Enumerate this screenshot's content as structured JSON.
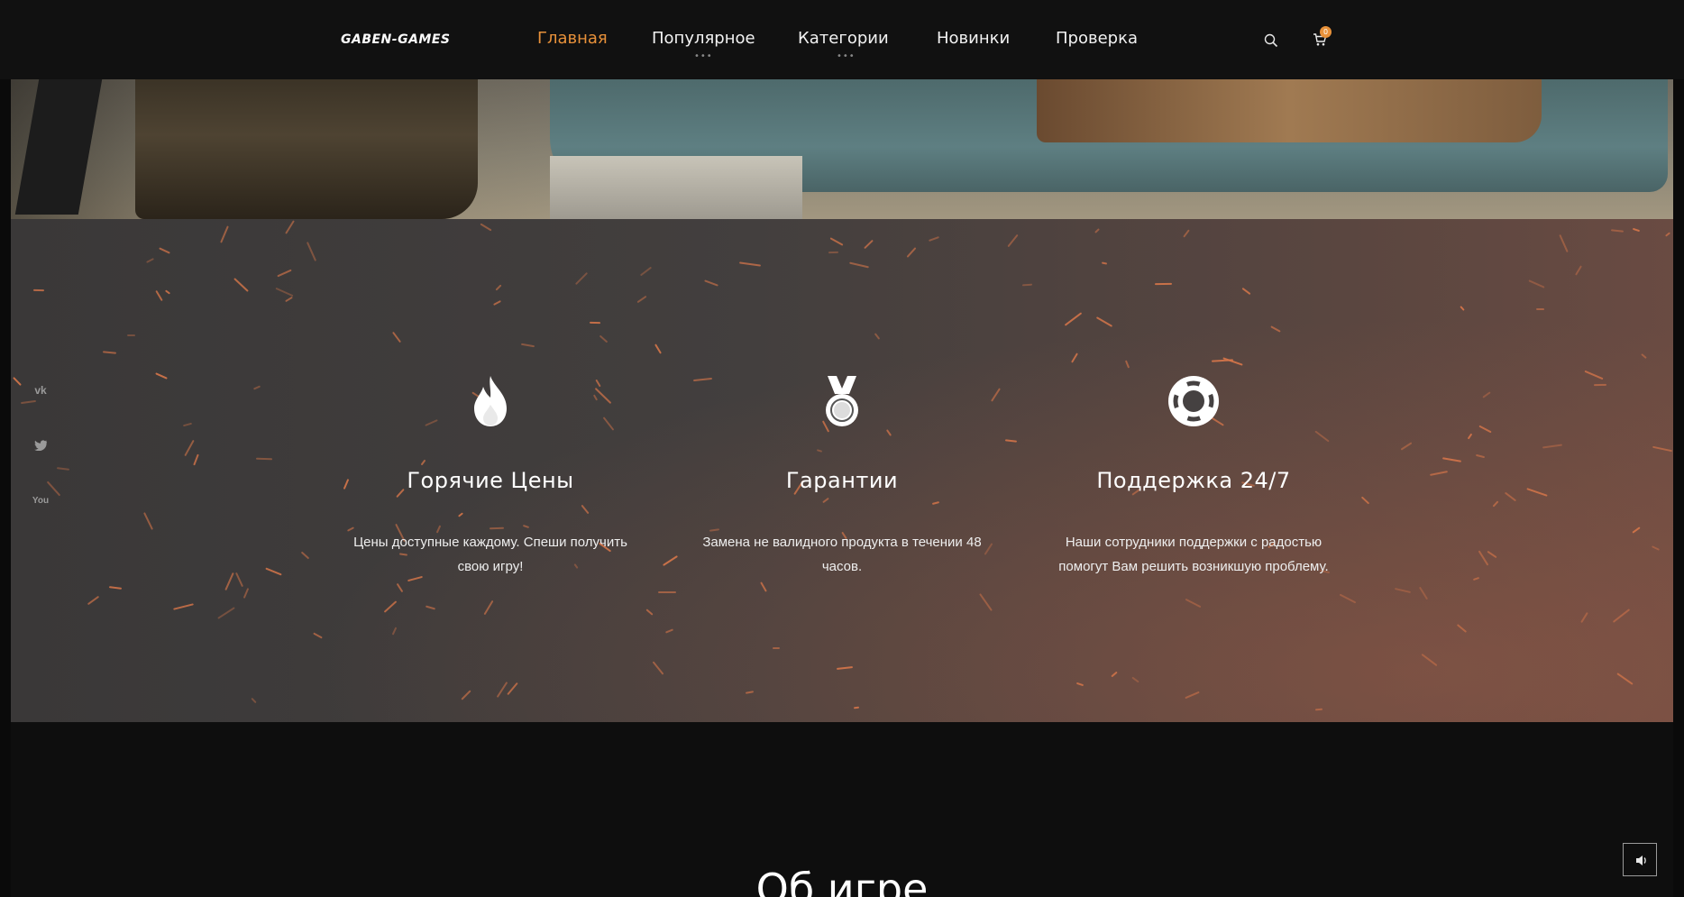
{
  "header": {
    "logo": "GABEN-GAMES",
    "nav": [
      {
        "label": "Главная",
        "active": true,
        "has_submenu": false
      },
      {
        "label": "Популярное",
        "active": false,
        "has_submenu": true
      },
      {
        "label": "Категории",
        "active": false,
        "has_submenu": true
      },
      {
        "label": "Новинки",
        "active": false,
        "has_submenu": false
      },
      {
        "label": "Проверка",
        "active": false,
        "has_submenu": false
      }
    ],
    "submenu_indicator": "•••",
    "search_icon": "search-icon",
    "cart_icon": "cart-icon",
    "cart_count": "0"
  },
  "features": [
    {
      "icon": "fire-icon",
      "title": "Горячие Цены",
      "text": "Цены доступные каждому. Спеши получить свою игру!"
    },
    {
      "icon": "medal-icon",
      "title": "Гарантии",
      "text": "Замена не валидного продукта в течении 48 часов."
    },
    {
      "icon": "lifebuoy-icon",
      "title": "Поддержка 24/7",
      "text": "Наши сотрудники поддержки с радостью помогут Вам решить возникшую проблему."
    }
  ],
  "social": [
    {
      "icon": "vk-icon",
      "glyph": "vk"
    },
    {
      "icon": "twitter-icon",
      "glyph": "🐦"
    },
    {
      "icon": "youtube-icon",
      "glyph": "You"
    }
  ],
  "about": {
    "title": "Об игре"
  },
  "sound_button": {
    "icon": "speaker-icon"
  },
  "colors": {
    "accent": "#e8913a",
    "header_bg": "#111111",
    "page_bg": "#0e0e0e",
    "text": "#ffffff"
  }
}
